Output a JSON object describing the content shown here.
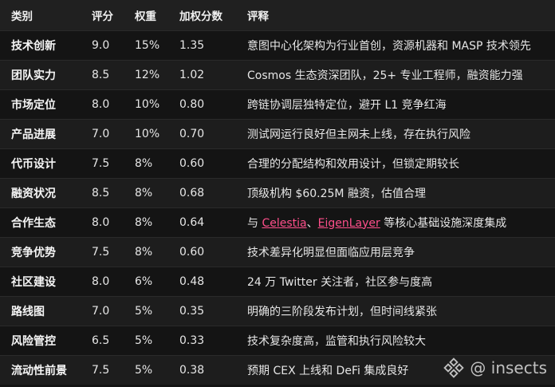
{
  "header": {
    "category": "类别",
    "score": "评分",
    "weight": "权重",
    "weighted_score": "加权分数",
    "comment": "评释"
  },
  "rows": [
    {
      "category": "技术创新",
      "score": "9.0",
      "weight": "15%",
      "weighted": "1.35",
      "comment": "意图中心化架构为行业首创，资源机器和 MASP 技术领先"
    },
    {
      "category": "团队实力",
      "score": "8.5",
      "weight": "12%",
      "weighted": "1.02",
      "comment": "Cosmos 生态资深团队，25+ 专业工程师，融资能力强"
    },
    {
      "category": "市场定位",
      "score": "8.0",
      "weight": "10%",
      "weighted": "0.80",
      "comment": "跨链协调层独特定位，避开 L1 竞争红海"
    },
    {
      "category": "产品进展",
      "score": "7.0",
      "weight": "10%",
      "weighted": "0.70",
      "comment": "测试网运行良好但主网未上线，存在执行风险"
    },
    {
      "category": "代币设计",
      "score": "7.5",
      "weight": "8%",
      "weighted": "0.60",
      "comment": "合理的分配结构和效用设计，但锁定期较长"
    },
    {
      "category": "融资状况",
      "score": "8.5",
      "weight": "8%",
      "weighted": "0.68",
      "comment": "顶级机构 $60.25M 融资，估值合理"
    },
    {
      "category": "合作生态",
      "score": "8.0",
      "weight": "8%",
      "weighted": "0.64",
      "comment_prefix": "与 ",
      "link1": "Celestia",
      "sep": "、",
      "link2": "EigenLayer",
      "comment_suffix": " 等核心基础设施深度集成"
    },
    {
      "category": "竞争优势",
      "score": "7.5",
      "weight": "8%",
      "weighted": "0.60",
      "comment": "技术差异化明显但面临应用层竞争"
    },
    {
      "category": "社区建设",
      "score": "8.0",
      "weight": "6%",
      "weighted": "0.48",
      "comment": "24 万 Twitter 关注者，社区参与度高"
    },
    {
      "category": "路线图",
      "score": "7.0",
      "weight": "5%",
      "weighted": "0.35",
      "comment": "明确的三阶段发布计划，但时间线紧张"
    },
    {
      "category": "风险管控",
      "score": "6.5",
      "weight": "5%",
      "weighted": "0.33",
      "comment": "技术复杂度高，监管和执行风险较大"
    },
    {
      "category": "流动性前景",
      "score": "7.5",
      "weight": "5%",
      "weighted": "0.38",
      "comment": "预期 CEX 上线和 DeFi 集成良好"
    }
  ],
  "watermark": {
    "text": "@ insects",
    "icon": "binance-diamond-icon"
  },
  "colors": {
    "link": "#ff4f8b",
    "background": "#141414",
    "header_bg": "#202020"
  }
}
